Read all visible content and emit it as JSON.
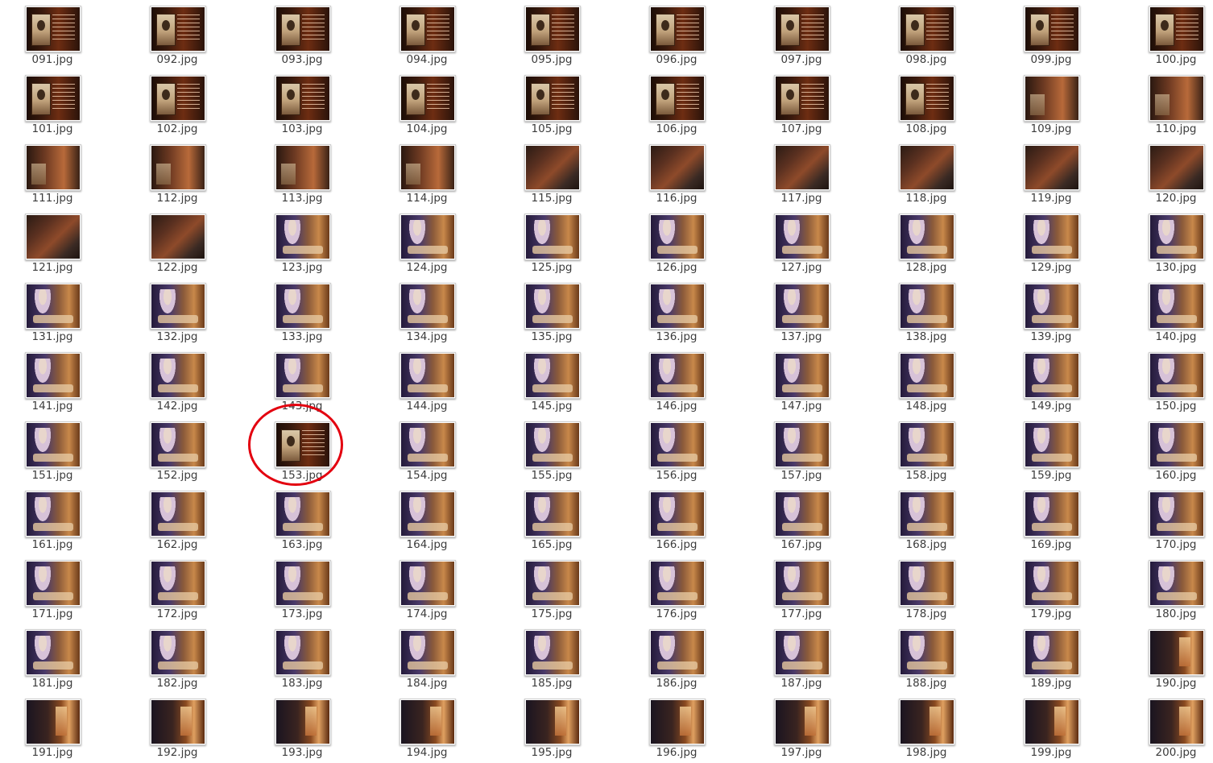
{
  "file_grid": {
    "files": [
      {
        "name": "091.jpg",
        "thumb": "portrait"
      },
      {
        "name": "092.jpg",
        "thumb": "portrait"
      },
      {
        "name": "093.jpg",
        "thumb": "portrait"
      },
      {
        "name": "094.jpg",
        "thumb": "portrait"
      },
      {
        "name": "095.jpg",
        "thumb": "portrait"
      },
      {
        "name": "096.jpg",
        "thumb": "portrait"
      },
      {
        "name": "097.jpg",
        "thumb": "portrait"
      },
      {
        "name": "098.jpg",
        "thumb": "portrait"
      },
      {
        "name": "099.jpg",
        "thumb": "portrait"
      },
      {
        "name": "100.jpg",
        "thumb": "portrait"
      },
      {
        "name": "101.jpg",
        "thumb": "portrait"
      },
      {
        "name": "102.jpg",
        "thumb": "portrait"
      },
      {
        "name": "103.jpg",
        "thumb": "portrait"
      },
      {
        "name": "104.jpg",
        "thumb": "portrait"
      },
      {
        "name": "105.jpg",
        "thumb": "portrait"
      },
      {
        "name": "106.jpg",
        "thumb": "portrait"
      },
      {
        "name": "107.jpg",
        "thumb": "portrait"
      },
      {
        "name": "108.jpg",
        "thumb": "portrait"
      },
      {
        "name": "109.jpg",
        "thumb": "fade"
      },
      {
        "name": "110.jpg",
        "thumb": "fade"
      },
      {
        "name": "111.jpg",
        "thumb": "fade"
      },
      {
        "name": "112.jpg",
        "thumb": "fade"
      },
      {
        "name": "113.jpg",
        "thumb": "fade"
      },
      {
        "name": "114.jpg",
        "thumb": "fade"
      },
      {
        "name": "115.jpg",
        "thumb": "texture"
      },
      {
        "name": "116.jpg",
        "thumb": "texture"
      },
      {
        "name": "117.jpg",
        "thumb": "texture"
      },
      {
        "name": "118.jpg",
        "thumb": "texture"
      },
      {
        "name": "119.jpg",
        "thumb": "texture"
      },
      {
        "name": "120.jpg",
        "thumb": "texture"
      },
      {
        "name": "121.jpg",
        "thumb": "texture"
      },
      {
        "name": "122.jpg",
        "thumb": "texture"
      },
      {
        "name": "123.jpg",
        "thumb": "scene"
      },
      {
        "name": "124.jpg",
        "thumb": "scene"
      },
      {
        "name": "125.jpg",
        "thumb": "scene"
      },
      {
        "name": "126.jpg",
        "thumb": "scene"
      },
      {
        "name": "127.jpg",
        "thumb": "scene"
      },
      {
        "name": "128.jpg",
        "thumb": "scene"
      },
      {
        "name": "129.jpg",
        "thumb": "scene"
      },
      {
        "name": "130.jpg",
        "thumb": "scene"
      },
      {
        "name": "131.jpg",
        "thumb": "scene"
      },
      {
        "name": "132.jpg",
        "thumb": "scene"
      },
      {
        "name": "133.jpg",
        "thumb": "scene"
      },
      {
        "name": "134.jpg",
        "thumb": "scene"
      },
      {
        "name": "135.jpg",
        "thumb": "scene"
      },
      {
        "name": "136.jpg",
        "thumb": "scene"
      },
      {
        "name": "137.jpg",
        "thumb": "scene"
      },
      {
        "name": "138.jpg",
        "thumb": "scene"
      },
      {
        "name": "139.jpg",
        "thumb": "scene"
      },
      {
        "name": "140.jpg",
        "thumb": "scene"
      },
      {
        "name": "141.jpg",
        "thumb": "scene"
      },
      {
        "name": "142.jpg",
        "thumb": "scene"
      },
      {
        "name": "143.jpg",
        "thumb": "scene"
      },
      {
        "name": "144.jpg",
        "thumb": "scene"
      },
      {
        "name": "145.jpg",
        "thumb": "scene"
      },
      {
        "name": "146.jpg",
        "thumb": "scene"
      },
      {
        "name": "147.jpg",
        "thumb": "scene"
      },
      {
        "name": "148.jpg",
        "thumb": "scene"
      },
      {
        "name": "149.jpg",
        "thumb": "scene"
      },
      {
        "name": "150.jpg",
        "thumb": "scene"
      },
      {
        "name": "151.jpg",
        "thumb": "scene"
      },
      {
        "name": "152.jpg",
        "thumb": "scene"
      },
      {
        "name": "153.jpg",
        "thumb": "portrait"
      },
      {
        "name": "154.jpg",
        "thumb": "scene"
      },
      {
        "name": "155.jpg",
        "thumb": "scene"
      },
      {
        "name": "156.jpg",
        "thumb": "scene"
      },
      {
        "name": "157.jpg",
        "thumb": "scene"
      },
      {
        "name": "158.jpg",
        "thumb": "scene"
      },
      {
        "name": "159.jpg",
        "thumb": "scene"
      },
      {
        "name": "160.jpg",
        "thumb": "scene"
      },
      {
        "name": "161.jpg",
        "thumb": "scene"
      },
      {
        "name": "162.jpg",
        "thumb": "scene"
      },
      {
        "name": "163.jpg",
        "thumb": "scene"
      },
      {
        "name": "164.jpg",
        "thumb": "scene"
      },
      {
        "name": "165.jpg",
        "thumb": "scene"
      },
      {
        "name": "166.jpg",
        "thumb": "scene"
      },
      {
        "name": "167.jpg",
        "thumb": "scene"
      },
      {
        "name": "168.jpg",
        "thumb": "scene"
      },
      {
        "name": "169.jpg",
        "thumb": "scene"
      },
      {
        "name": "170.jpg",
        "thumb": "scene"
      },
      {
        "name": "171.jpg",
        "thumb": "scene"
      },
      {
        "name": "172.jpg",
        "thumb": "scene"
      },
      {
        "name": "173.jpg",
        "thumb": "scene"
      },
      {
        "name": "174.jpg",
        "thumb": "scene"
      },
      {
        "name": "175.jpg",
        "thumb": "scene"
      },
      {
        "name": "176.jpg",
        "thumb": "scene"
      },
      {
        "name": "177.jpg",
        "thumb": "scene"
      },
      {
        "name": "178.jpg",
        "thumb": "scene"
      },
      {
        "name": "179.jpg",
        "thumb": "scene"
      },
      {
        "name": "180.jpg",
        "thumb": "scene"
      },
      {
        "name": "181.jpg",
        "thumb": "scene"
      },
      {
        "name": "182.jpg",
        "thumb": "scene"
      },
      {
        "name": "183.jpg",
        "thumb": "scene"
      },
      {
        "name": "184.jpg",
        "thumb": "scene"
      },
      {
        "name": "185.jpg",
        "thumb": "scene"
      },
      {
        "name": "186.jpg",
        "thumb": "scene"
      },
      {
        "name": "187.jpg",
        "thumb": "scene"
      },
      {
        "name": "188.jpg",
        "thumb": "scene"
      },
      {
        "name": "189.jpg",
        "thumb": "scene"
      },
      {
        "name": "190.jpg",
        "thumb": "night"
      },
      {
        "name": "191.jpg",
        "thumb": "night"
      },
      {
        "name": "192.jpg",
        "thumb": "night"
      },
      {
        "name": "193.jpg",
        "thumb": "night"
      },
      {
        "name": "194.jpg",
        "thumb": "night"
      },
      {
        "name": "195.jpg",
        "thumb": "night"
      },
      {
        "name": "196.jpg",
        "thumb": "night"
      },
      {
        "name": "197.jpg",
        "thumb": "night"
      },
      {
        "name": "198.jpg",
        "thumb": "night"
      },
      {
        "name": "199.jpg",
        "thumb": "night"
      },
      {
        "name": "200.jpg",
        "thumb": "night"
      }
    ]
  },
  "annotation": {
    "highlighted_file": "153.jpg",
    "color": "#e3000f"
  }
}
